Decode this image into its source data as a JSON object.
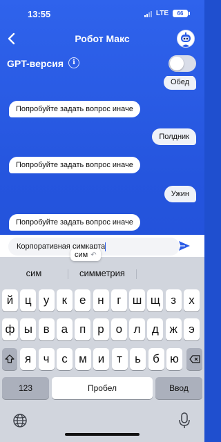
{
  "status_bar": {
    "time": "13:55",
    "network": "LTE",
    "battery": "66"
  },
  "header": {
    "title": "Робот Макс",
    "back_icon": "chevron-left-icon",
    "avatar_icon": "robot-avatar-icon"
  },
  "gpt": {
    "label": "GPT-версия",
    "info": "i",
    "toggle_on": false
  },
  "chat": {
    "messages": [
      {
        "from": "user",
        "text": "Обед"
      },
      {
        "from": "bot",
        "text": "Попробуйте задать вопрос иначе"
      },
      {
        "from": "user",
        "text": "Полдник"
      },
      {
        "from": "bot",
        "text": "Попробуйте задать вопрос иначе"
      },
      {
        "from": "user",
        "text": "Ужин"
      },
      {
        "from": "bot",
        "text": "Попробуйте задать вопрос иначе"
      }
    ]
  },
  "input": {
    "value": "Корпоративная симкарта",
    "send_icon": "send-icon"
  },
  "autocorrect": {
    "text": "сим",
    "undo": "↶"
  },
  "keyboard": {
    "suggestions": [
      "сим",
      "симметрия",
      ""
    ],
    "row1": [
      "й",
      "ц",
      "у",
      "к",
      "е",
      "н",
      "г",
      "ш",
      "щ",
      "з",
      "х"
    ],
    "row2": [
      "ф",
      "ы",
      "в",
      "а",
      "п",
      "р",
      "о",
      "л",
      "д",
      "ж",
      "э"
    ],
    "row3": [
      "я",
      "ч",
      "с",
      "м",
      "и",
      "т",
      "ь",
      "б",
      "ю"
    ],
    "shift_icon": "shift-icon",
    "delete_icon": "backspace-icon",
    "numbers_label": "123",
    "space_label": "Пробел",
    "return_label": "Ввод",
    "globe_icon": "globe-icon",
    "mic_icon": "microphone-icon"
  },
  "colors": {
    "accent": "#2a5be6",
    "background": "#2555de",
    "keyboard": "#d1d5dd"
  }
}
